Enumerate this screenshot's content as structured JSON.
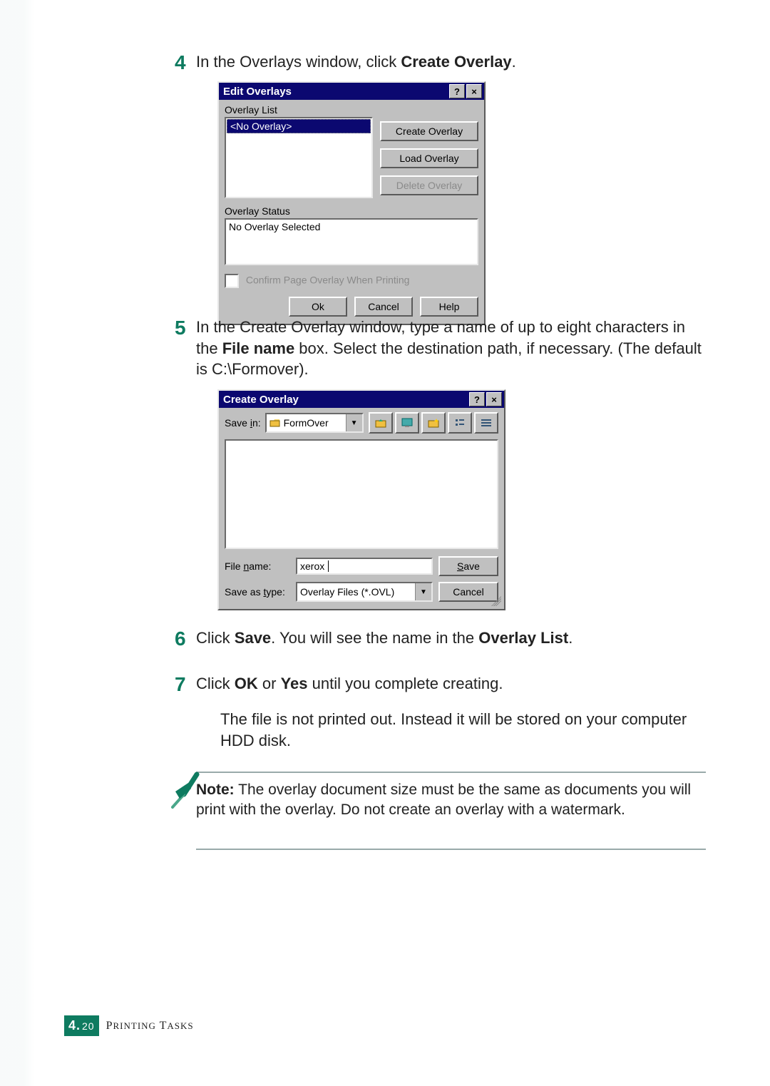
{
  "steps": {
    "s4": {
      "num": "4",
      "pre": "In the Overlays window, click ",
      "bold": "Create Overlay",
      "post": "."
    },
    "s5": {
      "num": "5",
      "pre": "In the Create Overlay window, type a name of up to eight characters in the ",
      "bold": "File name",
      "post": " box. Select the destination path, if necessary. (The default is C:\\Formover)."
    },
    "s6": {
      "num": "6",
      "pre": "Click ",
      "b1": "Save",
      "mid": ". You will see the name in the ",
      "b2": "Overlay List",
      "post": "."
    },
    "s7": {
      "num": "7",
      "pre": "Click ",
      "b1": "OK",
      "mid": " or ",
      "b2": "Yes",
      "post": " until you complete creating."
    },
    "s7b": "The file is not printed out. Instead it will be stored on your computer HDD disk."
  },
  "edit_overlays": {
    "title": "Edit Overlays",
    "list_label": "Overlay List",
    "selected_item": "<No Overlay>",
    "status_label": "Overlay Status",
    "status_text": "No Overlay Selected",
    "confirm_label": "Confirm Page Overlay When Printing",
    "buttons": {
      "create": "Create Overlay",
      "load": "Load Overlay",
      "delete": "Delete Overlay",
      "ok": "Ok",
      "cancel": "Cancel",
      "help": "Help"
    }
  },
  "create_overlay": {
    "title": "Create Overlay",
    "save_in_label": "Save in:",
    "save_in_value": "FormOver",
    "file_name_label": "File name:",
    "file_name_value": "xerox",
    "save_as_type_label": "Save as type:",
    "save_as_type_value": "Overlay Files (*.OVL)",
    "buttons": {
      "save": "Save",
      "cancel": "Cancel"
    }
  },
  "note": {
    "lead": "Note:",
    "text": " The overlay document size must be the same as documents you will print with the overlay. Do not create an overlay with a watermark."
  },
  "footer": {
    "chapter_num": "4.",
    "page_num": "20",
    "label": "Printing Tasks"
  },
  "glyphs": {
    "help": "?",
    "close": "×",
    "down": "▼"
  }
}
